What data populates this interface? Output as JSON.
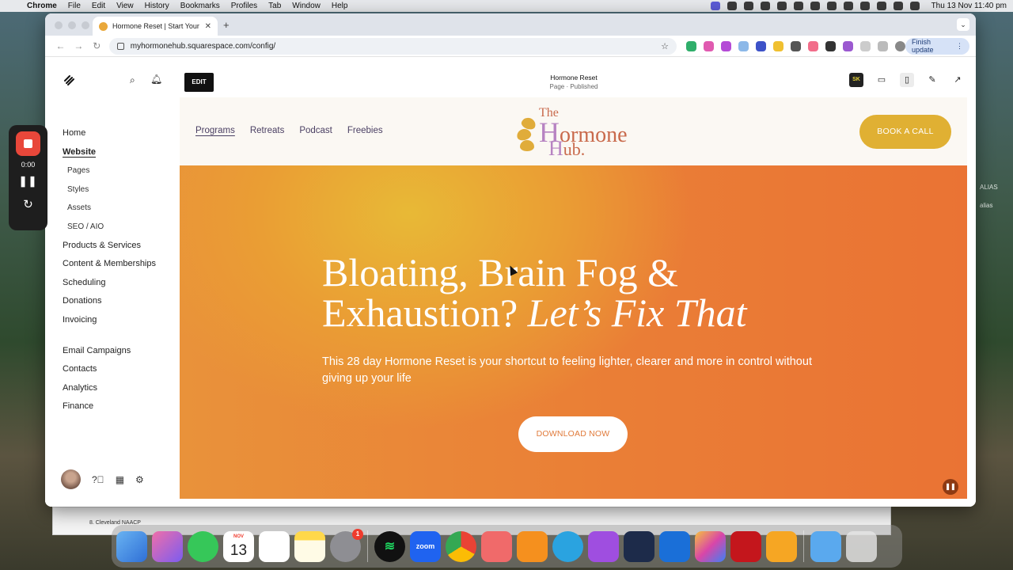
{
  "menubar": {
    "app_name": "Chrome",
    "items": [
      "File",
      "Edit",
      "View",
      "History",
      "Bookmarks",
      "Profiles",
      "Tab",
      "Window",
      "Help"
    ],
    "clock": "Thu 13 Nov  11:40 pm"
  },
  "desktop": {
    "side_labels": [
      "ALIAS",
      "alias",
      "ALIAS",
      "alias",
      "alias"
    ]
  },
  "background_window": {
    "row_text": "8. Cleveland NAACP"
  },
  "browser": {
    "tab_title": "Hormone Reset | Start Your H",
    "url": "myhormonehub.squarespace.com/config/",
    "finish_update_label": "Finish update"
  },
  "recorder": {
    "time": "0:00"
  },
  "squarespace": {
    "nav": [
      {
        "label": "Home"
      },
      {
        "label": "Website",
        "active": true
      },
      {
        "label": "Pages",
        "sub": true
      },
      {
        "label": "Styles",
        "sub": true
      },
      {
        "label": "Assets",
        "sub": true
      },
      {
        "label": "SEO / AIO",
        "sub": true
      },
      {
        "label": "Products & Services"
      },
      {
        "label": "Content & Memberships"
      },
      {
        "label": "Scheduling"
      },
      {
        "label": "Donations"
      },
      {
        "label": "Invoicing"
      },
      {
        "label": "Email Campaigns"
      },
      {
        "label": "Contacts"
      },
      {
        "label": "Analytics"
      },
      {
        "label": "Finance"
      }
    ],
    "edit_label": "EDIT",
    "page_title": "Hormone Reset",
    "page_status": "Page · Published",
    "sk_label": "SK"
  },
  "site": {
    "links": [
      "Programs",
      "Retreats",
      "Podcast",
      "Freebies"
    ],
    "logo": {
      "the": "The",
      "h": "H",
      "ormone": "ormone",
      "hub": "ub."
    },
    "book_label": "BOOK A CALL",
    "headline_plain": "Bloating, Brain Fog & Exhaustion? ",
    "headline_italic": "Let’s Fix That",
    "lead": "This 28 day Hormone Reset is your shortcut to feeling lighter, clearer and more in control without giving up your life",
    "cta_label": "DOWNLOAD NOW"
  },
  "dock": {
    "calendar_month": "NOV",
    "calendar_day": "13",
    "settings_badge": "1",
    "zoom_label": "zoom"
  },
  "colors": {
    "accent_gold": "#e0b033",
    "hero_orange": "#ea7e36",
    "nav_text": "#4a3f63",
    "record_red": "#e8473a"
  }
}
